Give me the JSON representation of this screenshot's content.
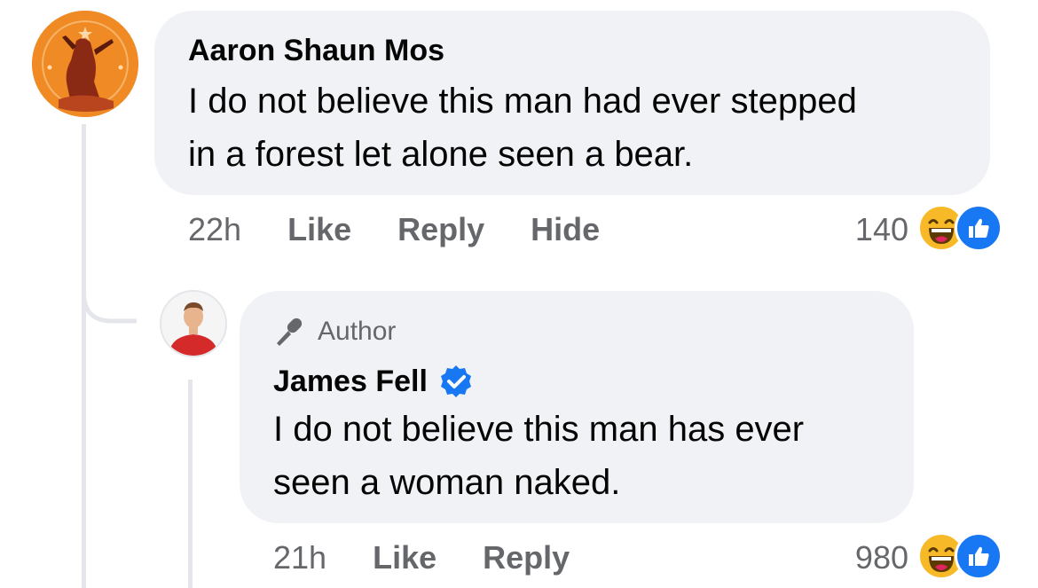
{
  "comment": {
    "author": "Aaron Shaun Mos",
    "text_line1": "I do not believe this man had ever stepped",
    "text_line2": "in a forest let alone seen a bear.",
    "time": "22h",
    "like_label": "Like",
    "reply_label": "Reply",
    "hide_label": "Hide",
    "reaction_count": "140",
    "reaction_icons": [
      "haha-icon",
      "like-icon"
    ]
  },
  "reply": {
    "badge_label": "Author",
    "author": "James Fell",
    "verified": true,
    "text_line1": "I do not believe this man has ever",
    "text_line2": "seen a woman naked.",
    "time": "21h",
    "like_label": "Like",
    "reply_label": "Reply",
    "reaction_count": "980",
    "reaction_icons": [
      "haha-icon",
      "like-icon"
    ]
  },
  "colors": {
    "bubble": "#f0f2f5",
    "meta_text": "#65676b",
    "like_blue": "#1877f2",
    "haha_yellow": "#f7b928",
    "verified_blue": "#1877f2",
    "thread_line": "#e4e6eb"
  }
}
